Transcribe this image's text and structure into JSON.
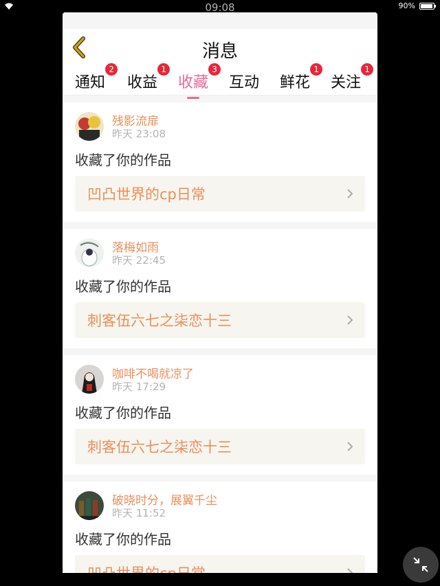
{
  "status": {
    "time": "09:08",
    "battery": "90%",
    "battery_level": 0.9
  },
  "header": {
    "title": "消息"
  },
  "tabs": [
    {
      "label": "通知",
      "badge": "2"
    },
    {
      "label": "收益",
      "badge": "1"
    },
    {
      "label": "收藏",
      "badge": "3",
      "active": true
    },
    {
      "label": "互动",
      "badge": ""
    },
    {
      "label": "鲜花",
      "badge": "1"
    },
    {
      "label": "关注",
      "badge": "1"
    }
  ],
  "messages": [
    {
      "name": "残影流扉",
      "time": "昨天 23:08",
      "action": "收藏了你的作品",
      "work": "凹凸世界的cp日常"
    },
    {
      "name": "落梅如雨",
      "time": "昨天 22:45",
      "action": "收藏了你的作品",
      "work": "刺客伍六七之柒恋十三"
    },
    {
      "name": "咖啡不喝就凉了",
      "time": "昨天 17:29",
      "action": "收藏了你的作品",
      "work": "刺客伍六七之柒恋十三"
    },
    {
      "name": "破晓时分，展翼千尘",
      "time": "昨天 11:52",
      "action": "收藏了你的作品",
      "work": "凹凸世界的cp日常"
    }
  ],
  "colors": {
    "accent": "#e56a9a",
    "name": "#ea8f5b",
    "badge": "#e8263b",
    "back_arrow": "#c8a21a"
  }
}
